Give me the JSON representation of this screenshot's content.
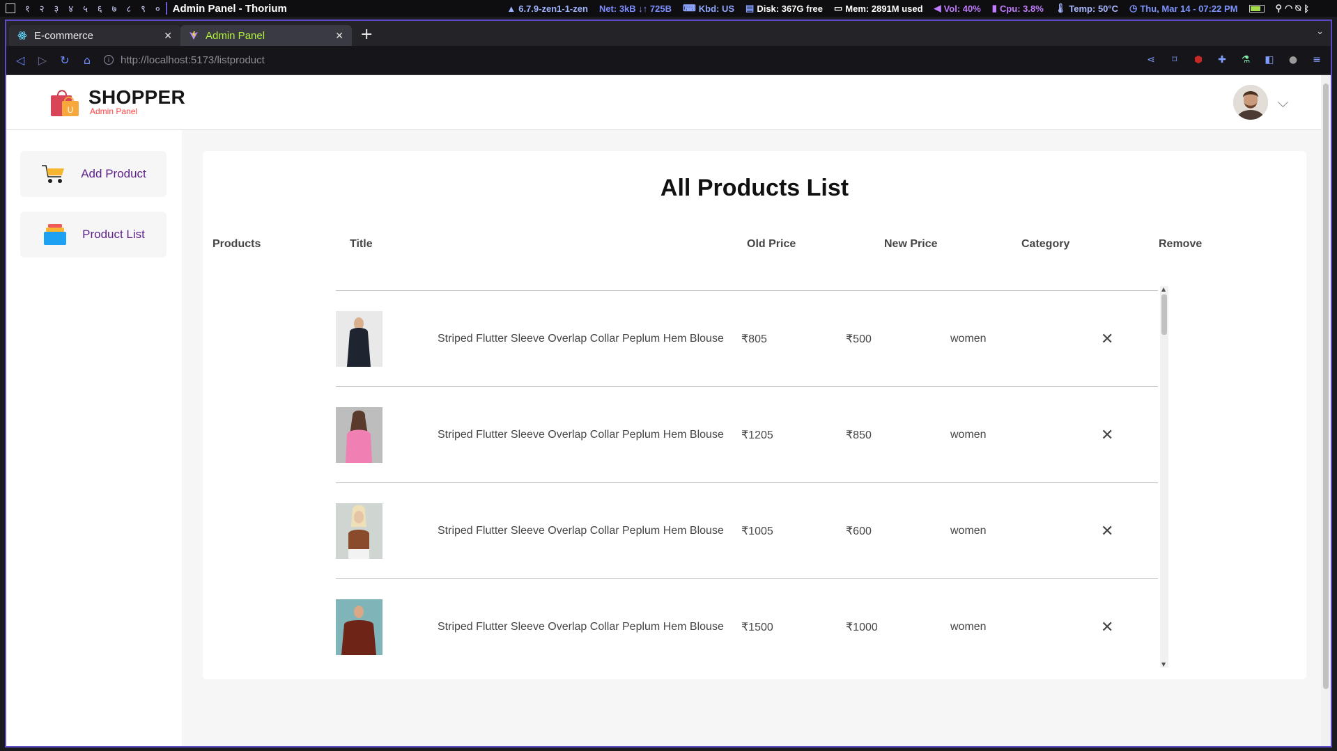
{
  "statusbar": {
    "workspaces": [
      "१",
      "२",
      "३",
      "४",
      "५",
      "६",
      "७",
      "८",
      "९",
      "०"
    ],
    "window_title": "Admin Panel - Thorium",
    "kernel": "6.7.9-zen1-1-zen",
    "net": "Net: 3kB ↓↑ 725B",
    "kbd": "Kbd: US",
    "disk": "Disk: 367G free",
    "mem": "Mem: 2891M used",
    "vol": "Vol: 40%",
    "cpu": "Cpu: 3.8%",
    "temp": "Temp: 50°C",
    "datetime": "Thu, Mar 14 - 07:22 PM",
    "battery_level": 0.85,
    "colors": {
      "kernel": "#9db1ff",
      "net": "#7b8cff",
      "kbd": "#8fa6ff",
      "disk": "#ffffff",
      "mem": "#ffffff",
      "vol": "#c07bff",
      "cpu": "#c07bff",
      "temp": "#a9b8ff",
      "datetime": "#7d94ff"
    }
  },
  "browser": {
    "tabs": [
      {
        "label": "E-commerce",
        "icon": "react-icon",
        "active": false
      },
      {
        "label": "Admin Panel",
        "icon": "vite-icon",
        "active": true
      }
    ],
    "url_host": "http://localhost",
    "url_rest": ":5173/listproduct"
  },
  "navbar": {
    "brand": "SHOPPER",
    "subtitle": "Admin Panel",
    "bag_letter": "U"
  },
  "sidebar": {
    "items": [
      {
        "label": "Add Product",
        "icon": "shopping-cart-icon"
      },
      {
        "label": "Product List",
        "icon": "stacked-list-icon"
      }
    ]
  },
  "page": {
    "title": "All Products List",
    "columns": [
      "Products",
      "Title",
      "Old Price",
      "New Price",
      "Category",
      "Remove"
    ]
  },
  "products": [
    {
      "title": "Striped Flutter Sleeve Overlap Collar Peplum Hem Blouse",
      "old_price": "₹805",
      "new_price": "₹500",
      "category": "women",
      "thumb_bg": "#e9e9e9",
      "thumb_fg": "#1e2430"
    },
    {
      "title": "Striped Flutter Sleeve Overlap Collar Peplum Hem Blouse",
      "old_price": "₹1205",
      "new_price": "₹850",
      "category": "women",
      "thumb_bg": "#bdbdbd",
      "thumb_fg": "#f07fb3"
    },
    {
      "title": "Striped Flutter Sleeve Overlap Collar Peplum Hem Blouse",
      "old_price": "₹1005",
      "new_price": "₹600",
      "category": "women",
      "thumb_bg": "#cfd6d2",
      "thumb_fg": "#8a4a2c"
    },
    {
      "title": "Striped Flutter Sleeve Overlap Collar Peplum Hem Blouse",
      "old_price": "₹1500",
      "new_price": "₹1000",
      "category": "women",
      "thumb_bg": "#7fb4b8",
      "thumb_fg": "#6e2417"
    }
  ]
}
